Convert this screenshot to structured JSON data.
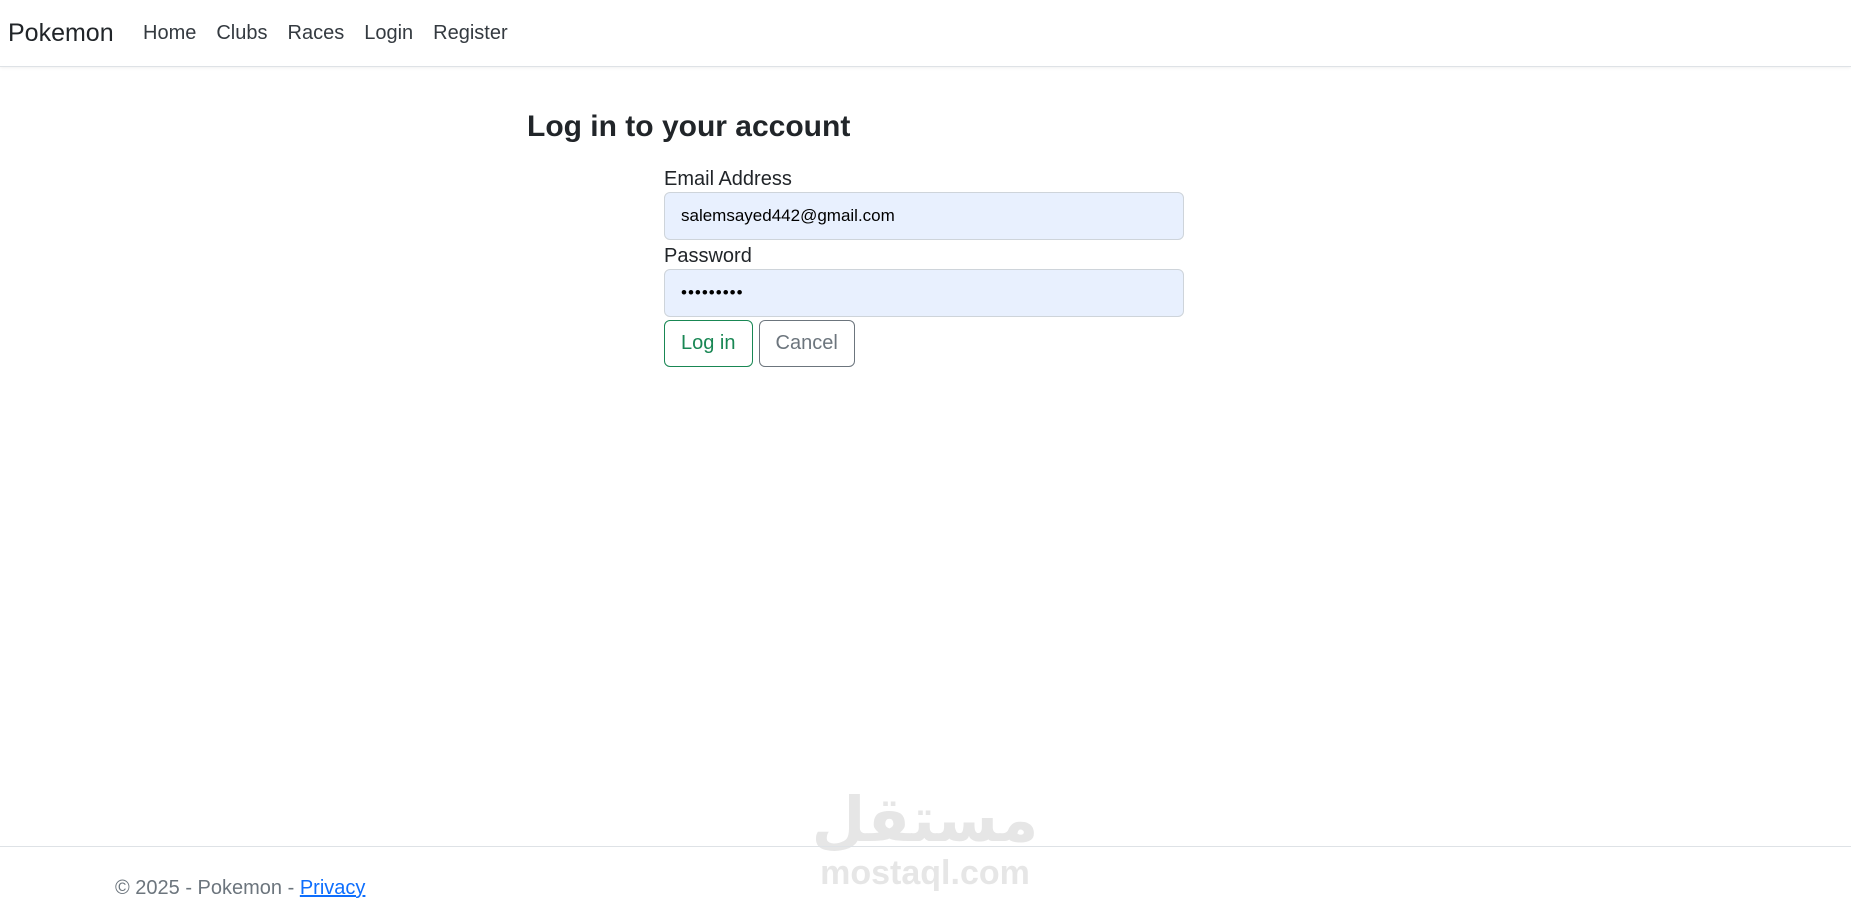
{
  "navbar": {
    "brand": "Pokemon",
    "links": [
      "Home",
      "Clubs",
      "Races",
      "Login",
      "Register"
    ]
  },
  "main": {
    "title": "Log in to your account",
    "email": {
      "label": "Email Address",
      "value": "salemsayed442@gmail.com"
    },
    "password": {
      "label": "Password",
      "value": "•••••••••"
    },
    "login_button": "Log in",
    "cancel_button": "Cancel"
  },
  "footer": {
    "copyright": "© 2025 - Pokemon - ",
    "privacy_link": "Privacy"
  },
  "watermark": {
    "arabic": "مستقل",
    "latin": "mostaql.com"
  },
  "colors": {
    "success": "#198754",
    "secondary": "#6c757d",
    "link": "#0d6efd",
    "autofill_bg": "#e8f0fe"
  }
}
